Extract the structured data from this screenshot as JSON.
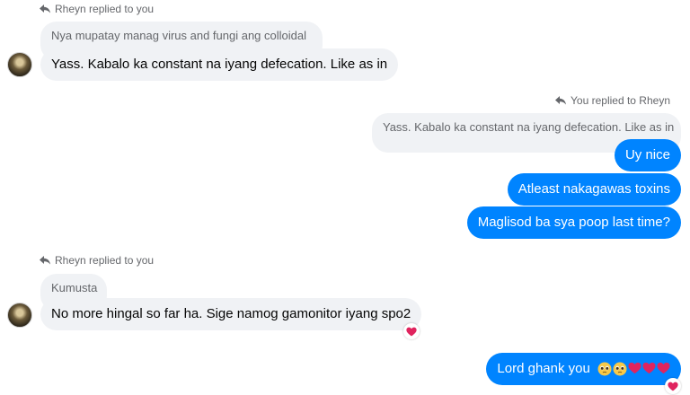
{
  "thread": {
    "reply_note_1": "Rheyn replied to you",
    "quoted_1": "Nya mupatay manag virus and fungi ang colloidal",
    "msg_in_1": "Yass. Kabalo ka constant na iyang defecation. Like as in",
    "reply_note_2": "You replied to Rheyn",
    "quoted_2": "Yass. Kabalo ka constant na iyang defecation. Like as in",
    "msg_out_1": "Uy nice",
    "msg_out_2": "Atleast nakagawas toxins",
    "msg_out_3": "Maglisod ba sya poop last time?",
    "reply_note_3": "Rheyn replied to you",
    "quoted_3": "Kumusta",
    "msg_in_2": "No more hingal so far ha. Sige namog gamonitor iyang spo2",
    "msg_in_2_reaction": "heart",
    "msg_out_4": "Lord ghank you",
    "msg_out_4_emojis": [
      "pleading-face",
      "pleading-face",
      "red-heart",
      "red-heart",
      "red-heart"
    ],
    "msg_out_4_reaction": "heart"
  },
  "colors": {
    "outgoing_bubble": "#0084ff",
    "incoming_bubble": "#f0f2f5",
    "secondary_text": "#65676b",
    "heart": "#e0245e"
  }
}
